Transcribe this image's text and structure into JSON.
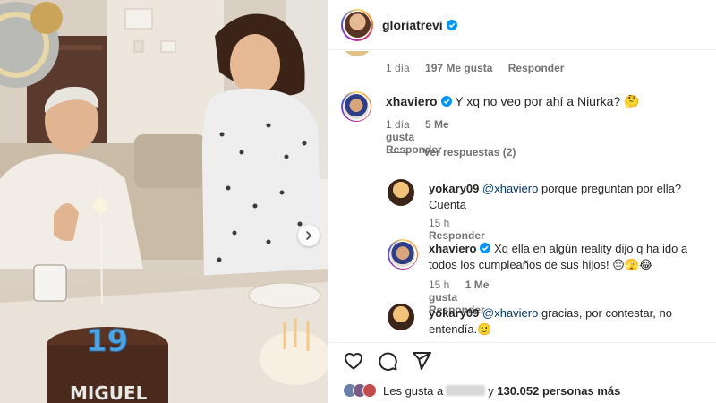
{
  "post": {
    "author": "gloriatrevi",
    "photo_cake_number": "19",
    "photo_cake_text": "MIGUEL"
  },
  "comments": {
    "top_meta": {
      "time": "1 día",
      "likes": "197 Me gusta",
      "reply": "Responder"
    },
    "items": [
      {
        "user": "xhaviero",
        "text": "Y xq no veo por ahí a Niurka? 🤔",
        "time": "1 día",
        "likes": "5 Me gusta",
        "reply": "Responder"
      }
    ],
    "view_replies": "Ver respuestas (2)",
    "replies": [
      {
        "user": "yokary09",
        "mention": "@xhaviero",
        "text": " porque preguntan por ella? Cuenta",
        "time": "15 h",
        "reply": "Responder"
      },
      {
        "user": "xhaviero",
        "text": "Xq ella en algún reality dijo q ha ido a todos los cumpleaños de sus hijos! 😑🫣😂",
        "time": "15 h",
        "likes": "1 Me gusta",
        "reply": "Responder"
      },
      {
        "user": "yokary09",
        "mention": "@xhaviero",
        "text": " gracias, por contestar, no entendía.🙂"
      }
    ]
  },
  "likes_bar": {
    "prefix": "Les gusta a",
    "conjunction": "y",
    "count": "130.052 personas más"
  },
  "colors": {
    "verified": "#0095f6",
    "mention": "#00376b",
    "secondary_text": "#737373"
  },
  "icons": [
    "heart-icon",
    "comment-icon",
    "share-icon",
    "verified-badge-icon",
    "chevron-right-icon"
  ]
}
